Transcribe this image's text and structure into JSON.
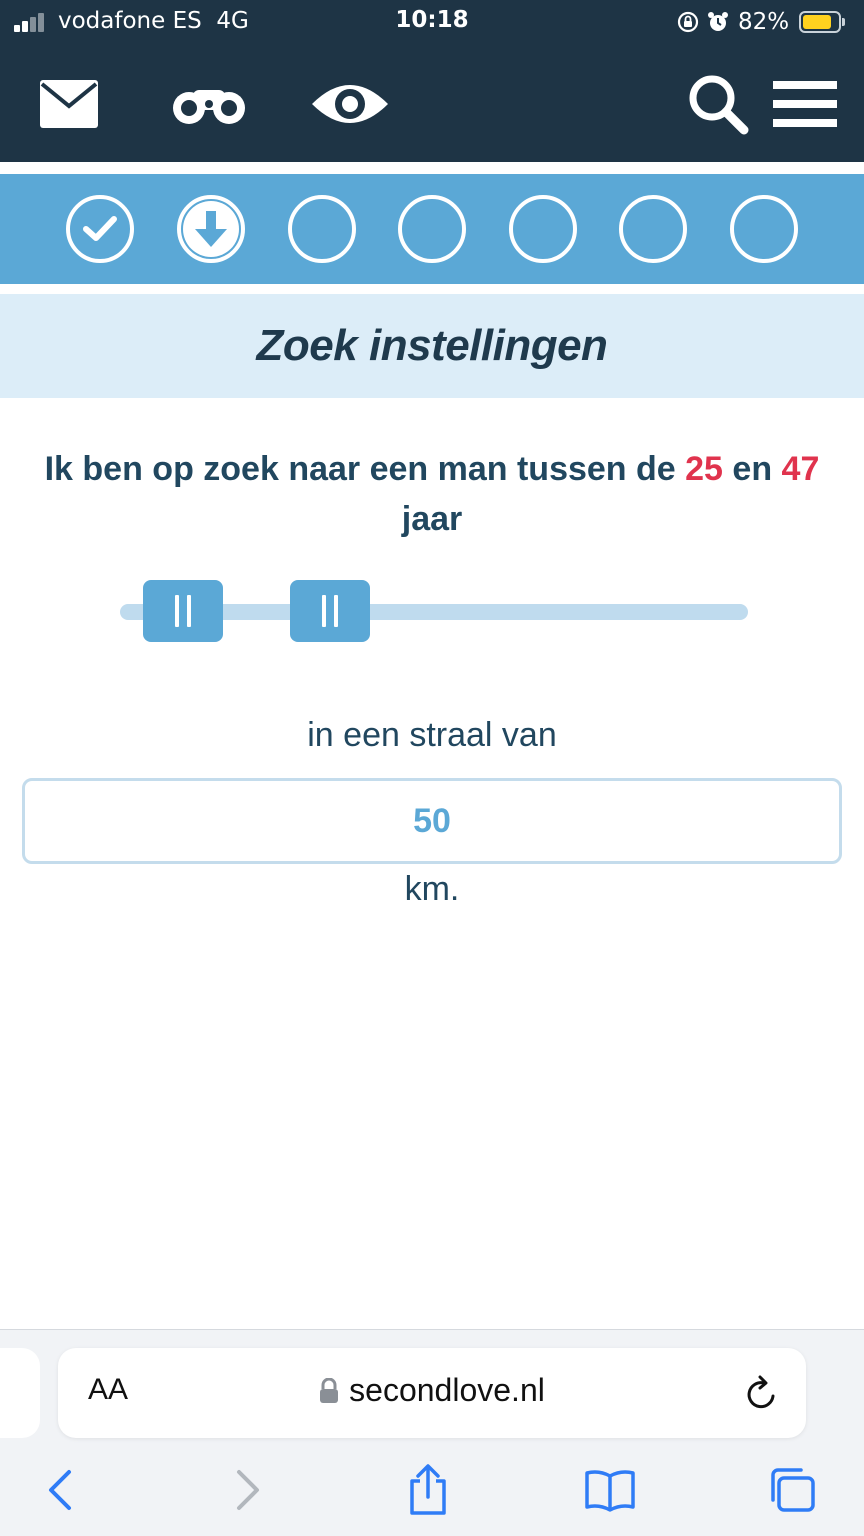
{
  "status_bar": {
    "carrier": "vodafone ES",
    "network": "4G",
    "time": "10:18",
    "battery_percent": "82%",
    "battery_level": 0.82,
    "icons": [
      "signal-icon",
      "orientation-lock-icon",
      "alarm-icon",
      "battery-icon"
    ]
  },
  "header": {
    "icons": [
      "mail-icon",
      "binoculars-icon",
      "eye-icon",
      "search-icon",
      "menu-icon"
    ]
  },
  "steps": [
    {
      "state": "done",
      "icon": "check-icon"
    },
    {
      "state": "current",
      "icon": "arrow-down-icon"
    },
    {
      "state": "pending"
    },
    {
      "state": "pending"
    },
    {
      "state": "pending"
    },
    {
      "state": "pending"
    },
    {
      "state": "pending"
    }
  ],
  "page": {
    "title": "Zoek instellingen",
    "age_text_before": "Ik ben op zoek naar een man tussen de ",
    "age_min": "25",
    "age_between": " en ",
    "age_max": "47",
    "age_after": " jaar",
    "radius_label": "in een straal van",
    "radius_value": "50",
    "radius_unit": "km."
  },
  "browser": {
    "text_size_label": "AA",
    "url": "secondlove.nl",
    "toolbar_icons": [
      "back-icon",
      "forward-icon",
      "share-icon",
      "bookmarks-icon",
      "tabs-icon"
    ]
  },
  "colors": {
    "header_bg": "#1e3445",
    "accent_blue": "#5ba8d6",
    "title_band": "#dcedf8",
    "highlight_red": "#e0334d",
    "ios_blue": "#2f7cf6"
  }
}
